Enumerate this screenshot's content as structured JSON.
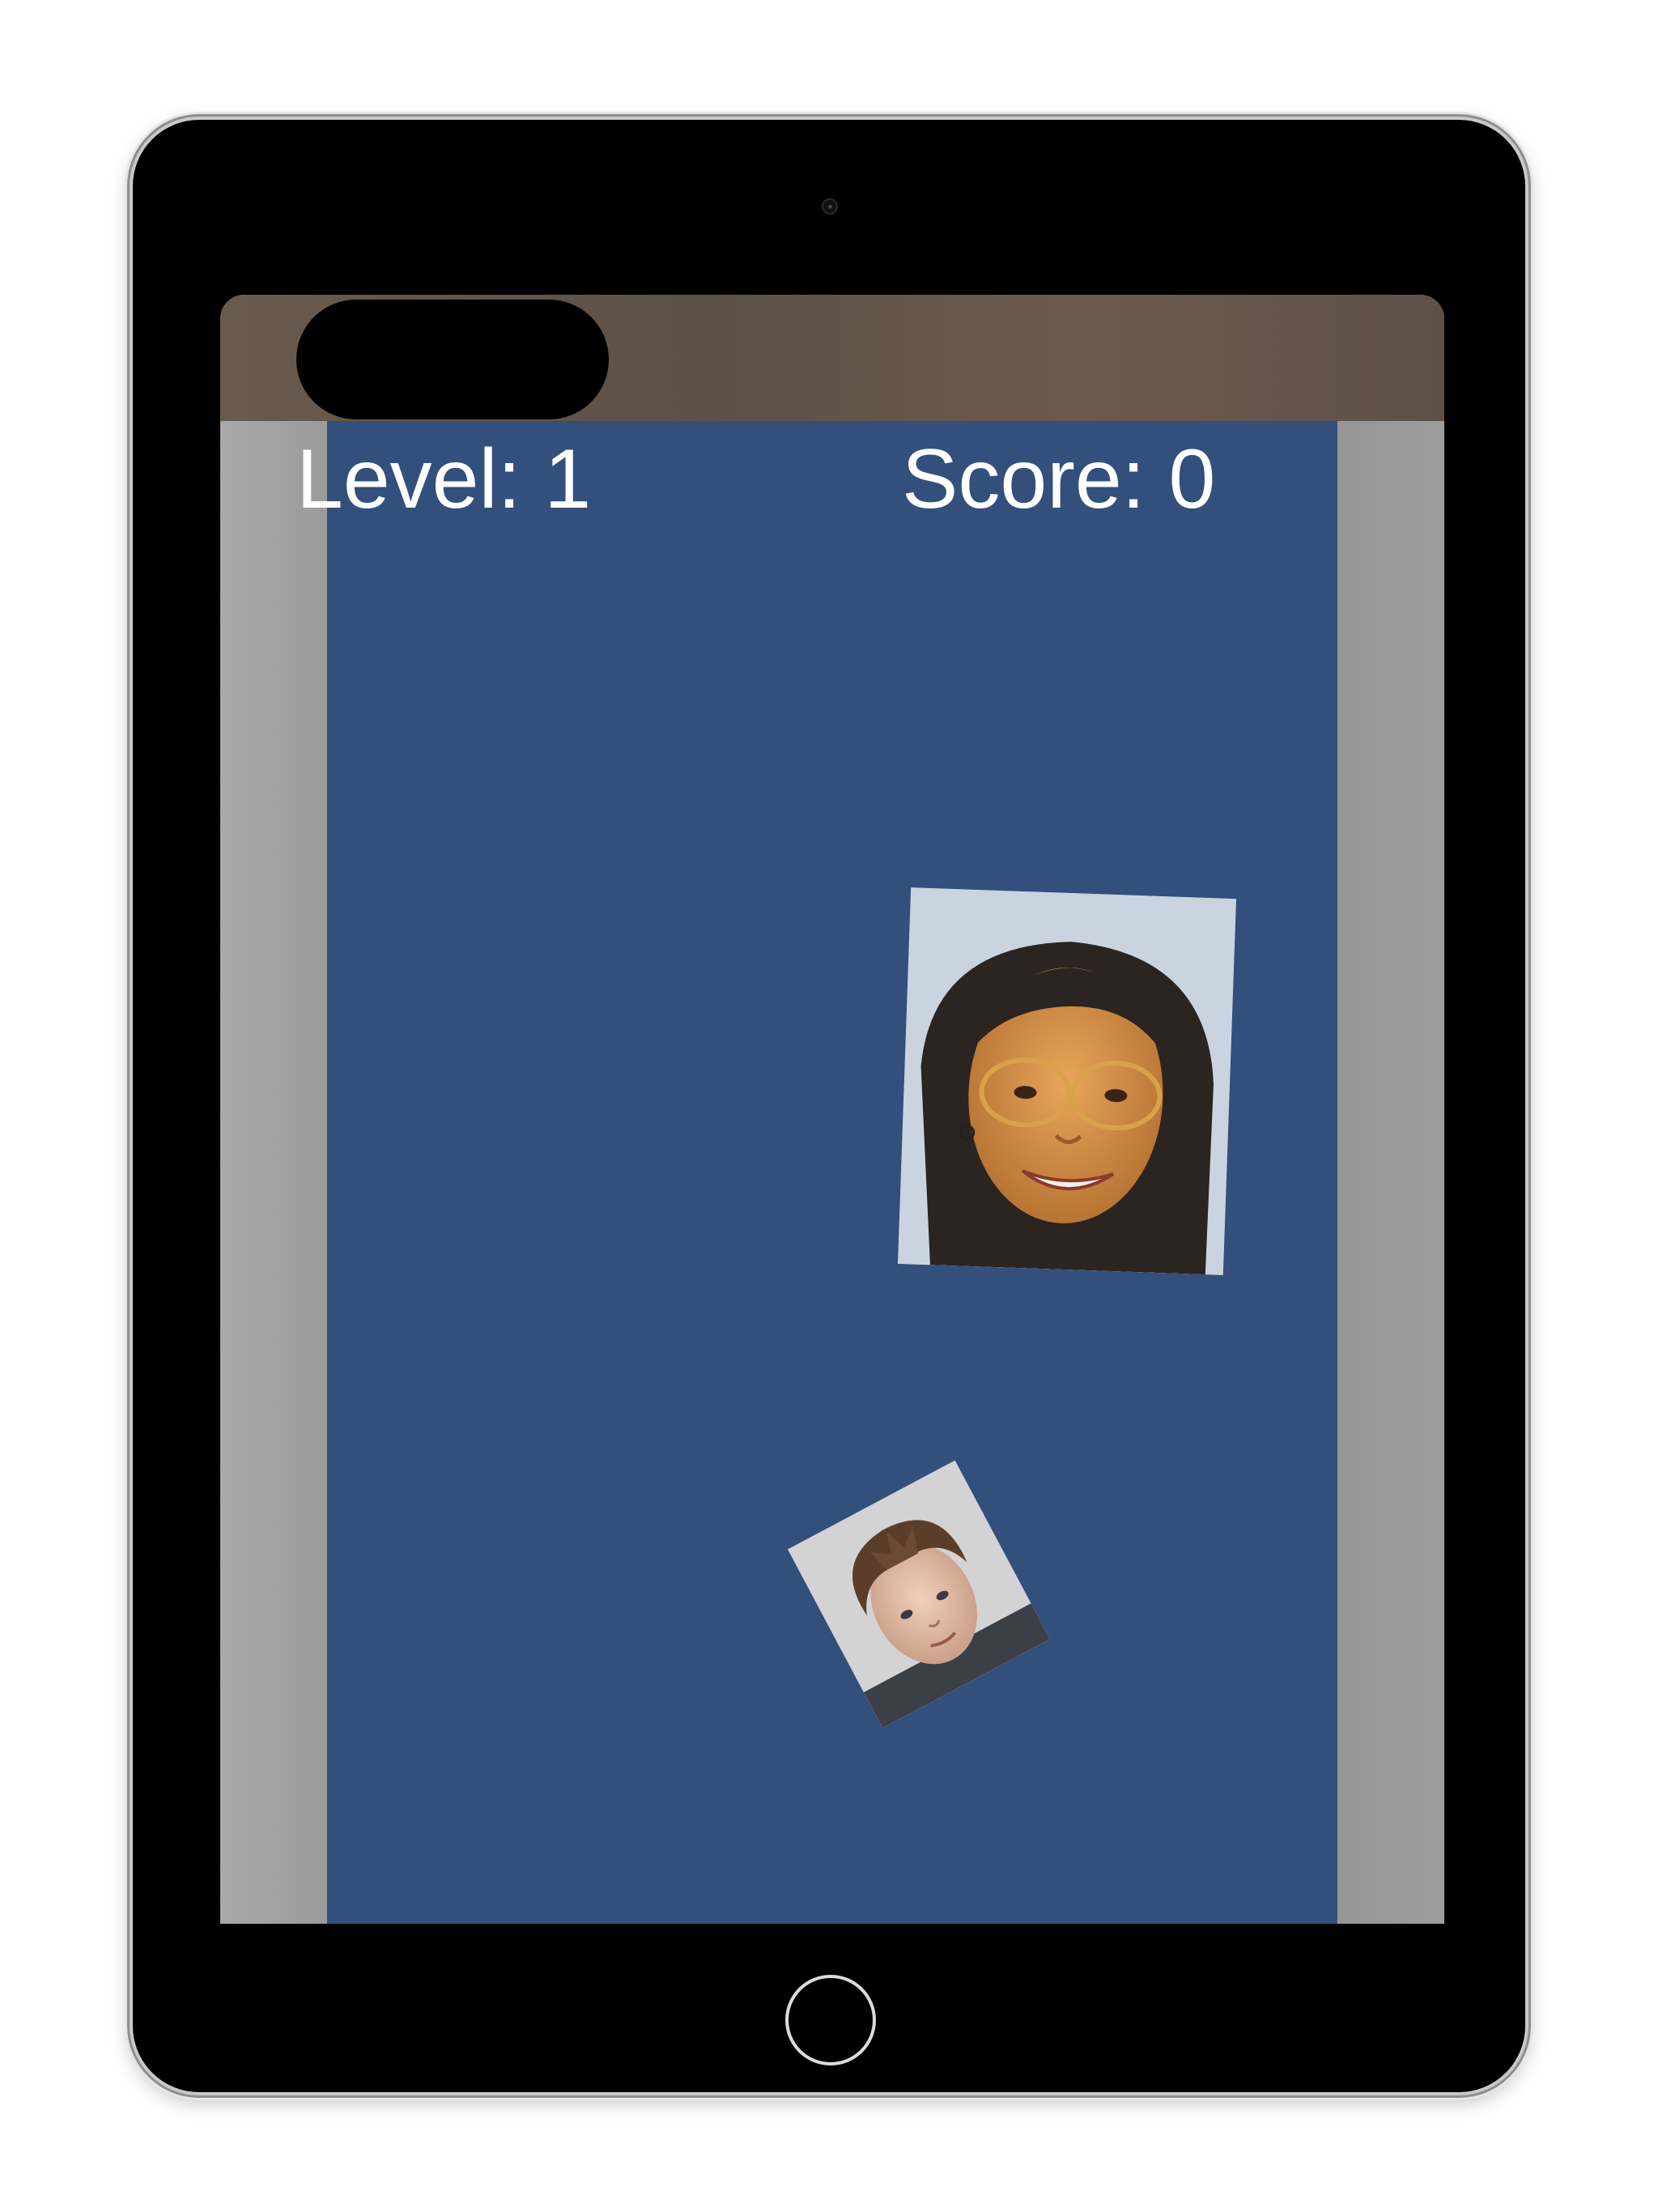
{
  "hud": {
    "level_label": "Level: 1",
    "score_label": "Score: 0"
  },
  "colors": {
    "play_field": "#334f7c",
    "side_panels": "#9a9a9a",
    "hud_text": "#ffffff",
    "device_bezel": "#000000"
  },
  "sprites": [
    {
      "name": "woman-face-photo",
      "description_icon": "face-photo-icon"
    },
    {
      "name": "boy-face-photo",
      "description_icon": "face-photo-icon"
    }
  ]
}
